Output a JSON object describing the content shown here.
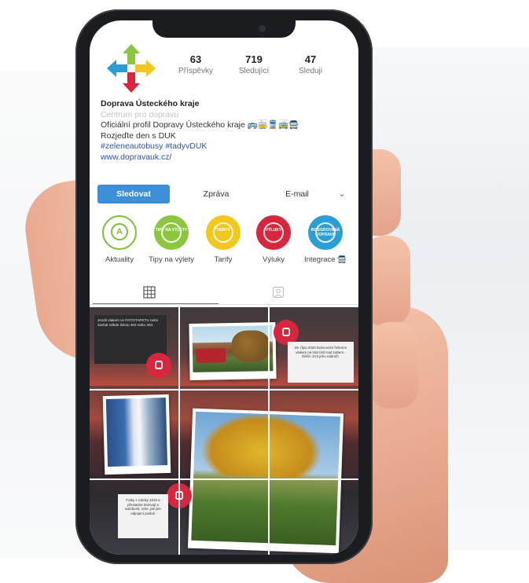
{
  "profile": {
    "name": "Doprava Ústeckého kraje",
    "category": "Centrum pro dopravu",
    "bio_line1": "Oficiální profil Dopravy Ústeckého kraje 🚌🚋🚆🚎🚍",
    "bio_line2": "Rozjeďte den s DUK",
    "hashtags": "#zeleneautobusy #tadyvDUK",
    "website": "www.dopravauk.cz/"
  },
  "stats": [
    {
      "value": "63",
      "label": "Příspěvky"
    },
    {
      "value": "719",
      "label": "Sledující"
    },
    {
      "value": "47",
      "label": "Sleduji"
    }
  ],
  "actions": {
    "follow": "Sledovat",
    "message": "Zpráva",
    "email": "E-mail",
    "more": "⌄"
  },
  "highlights": [
    {
      "label": "Aktuality",
      "inner": "A",
      "color": "#ffffff",
      "ring": "#7cbf3a"
    },
    {
      "label": "Tipy na výlety",
      "inner": "TIPY NA VÝLETY",
      "color": "#8cc63f",
      "ring": "#8cc63f"
    },
    {
      "label": "Tarify",
      "inner": "TARIFY",
      "color": "#f2c81f",
      "ring": "#f2c81f"
    },
    {
      "label": "Výluky",
      "inner": "VÝLUKY",
      "color": "#d7263d",
      "ring": "#d7263d"
    },
    {
      "label": "Integrace 🚍",
      "inner": "INTEGROVANÁ DOPRAVA",
      "color": "#2a9fd6",
      "ring": "#2a9fd6"
    }
  ],
  "tabs": {
    "grid_icon": "grid-icon",
    "tagged_icon": "tagged-icon"
  },
  "posts": {
    "post1_text": "Jezdit vlakem ve FOTOTAPETU nebo zavítat někde linkou 402 nebo 403.",
    "post3_text": "28. října 2020 Dobrovolní řešením vlakem na trati Ústí nad Labem - Děčín 10 k jeho nádraží.",
    "post7_text": "Fotky z rubriky 2018 a přestavba tramvají a autobusů; vizte, jak jste odpojení poslali."
  },
  "colors": {
    "accent": "#3d8fd6",
    "brand_red": "#d7263d",
    "brand_green": "#8cc63f",
    "brand_yellow": "#f2c81f",
    "brand_blue": "#2a9fd6"
  }
}
